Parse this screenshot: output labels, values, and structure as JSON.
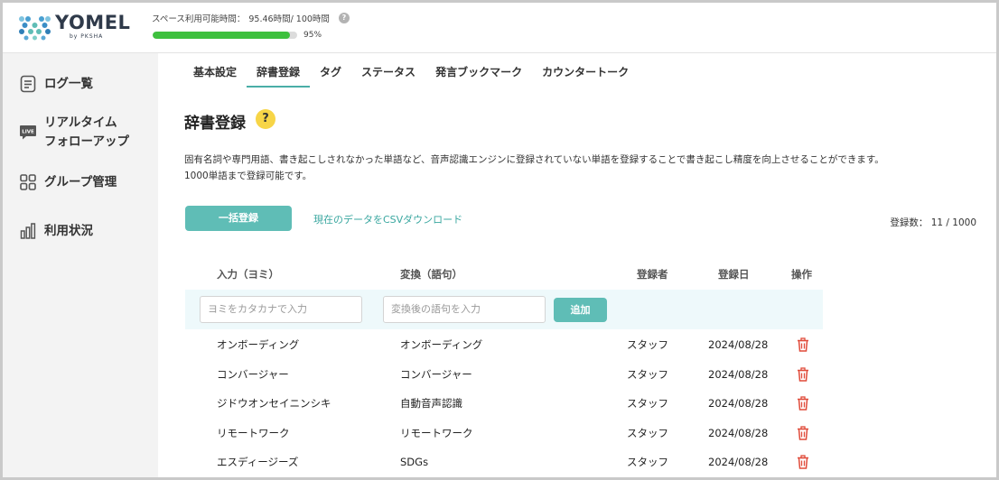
{
  "brand": {
    "name": "YOMEL",
    "sub": "by PKSHA"
  },
  "usage": {
    "label": "スペース利用可能時間：",
    "value": "95.46時間/ 100時間",
    "help": "?",
    "percent_text": "95%",
    "fraction": 0.95
  },
  "sidebar": {
    "items": [
      {
        "label_lines": [
          "ログ一覧"
        ],
        "icon": "document-list-icon"
      },
      {
        "label_lines": [
          "リアルタイム",
          "フォローアップ"
        ],
        "icon": "live-chat-icon"
      },
      {
        "label_lines": [
          "グループ管理"
        ],
        "icon": "grid-icon"
      },
      {
        "label_lines": [
          "利用状況"
        ],
        "icon": "bar-chart-icon"
      }
    ]
  },
  "tabs": [
    {
      "label": "基本設定",
      "active": false
    },
    {
      "label": "辞書登録",
      "active": true
    },
    {
      "label": "タグ",
      "active": false
    },
    {
      "label": "ステータス",
      "active": false
    },
    {
      "label": "発言ブックマーク",
      "active": false
    },
    {
      "label": "カウンタートーク",
      "active": false
    }
  ],
  "page": {
    "title": "辞書登録",
    "help": "?",
    "description_1": "固有名詞や専門用語、書き起こしされなかった単語など、音声認識エンジンに登録されていない単語を登録することで書き起こし精度を向上させることができます。",
    "description_2": "1000単語まで登録可能です。",
    "bulk_button": "一括登録",
    "csv_link": "現在のデータをCSVダウンロード",
    "count_label": "登録数：",
    "count_value": "11 / 1000"
  },
  "table": {
    "headers": {
      "reading": "入力（ヨミ）",
      "converted": "変換（語句）",
      "registrant": "登録者",
      "date": "登録日",
      "action": "操作"
    },
    "reading_placeholder": "ヨミをカタカナで入力",
    "converted_placeholder": "変換後の語句を入力",
    "add_button": "追加",
    "rows": [
      {
        "reading": "オンボーディング",
        "converted": "オンボーディング",
        "registrant": "スタッフ",
        "date": "2024/08/28"
      },
      {
        "reading": "コンバージャー",
        "converted": "コンバージャー",
        "registrant": "スタッフ",
        "date": "2024/08/28"
      },
      {
        "reading": "ジドウオンセイニンシキ",
        "converted": "自動音声認識",
        "registrant": "スタッフ",
        "date": "2024/08/28"
      },
      {
        "reading": "リモートワーク",
        "converted": "リモートワーク",
        "registrant": "スタッフ",
        "date": "2024/08/28"
      },
      {
        "reading": "エスディージーズ",
        "converted": "SDGs",
        "registrant": "スタッフ",
        "date": "2024/08/28"
      }
    ]
  },
  "colors": {
    "accent": "#5fbdb6",
    "link": "#3aa7a0",
    "progress": "#3ec03e",
    "delete": "#e04b3a",
    "help_badge": "#f7d547"
  }
}
